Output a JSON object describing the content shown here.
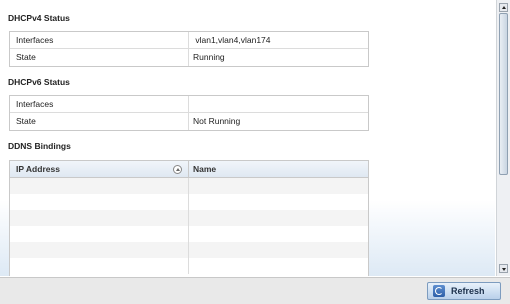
{
  "dhcpv4": {
    "title": "DHCPv4 Status",
    "rows": [
      {
        "key": "Interfaces",
        "value": " vlan1,vlan4,vlan174"
      },
      {
        "key": "State",
        "value": "Running"
      }
    ]
  },
  "dhcpv6": {
    "title": "DHCPv6 Status",
    "rows": [
      {
        "key": "Interfaces",
        "value": ""
      },
      {
        "key": "State",
        "value": "Not Running"
      }
    ]
  },
  "ddns": {
    "title": "DDNS Bindings",
    "columns": [
      "IP Address",
      "Name"
    ],
    "rows": []
  },
  "footer": {
    "refresh_label": "Refresh"
  },
  "icons": {
    "sort": "sort-ascending-icon",
    "refresh": "refresh-icon",
    "scroll_up": "scroll-up-arrow-icon",
    "scroll_down": "scroll-down-arrow-icon"
  }
}
